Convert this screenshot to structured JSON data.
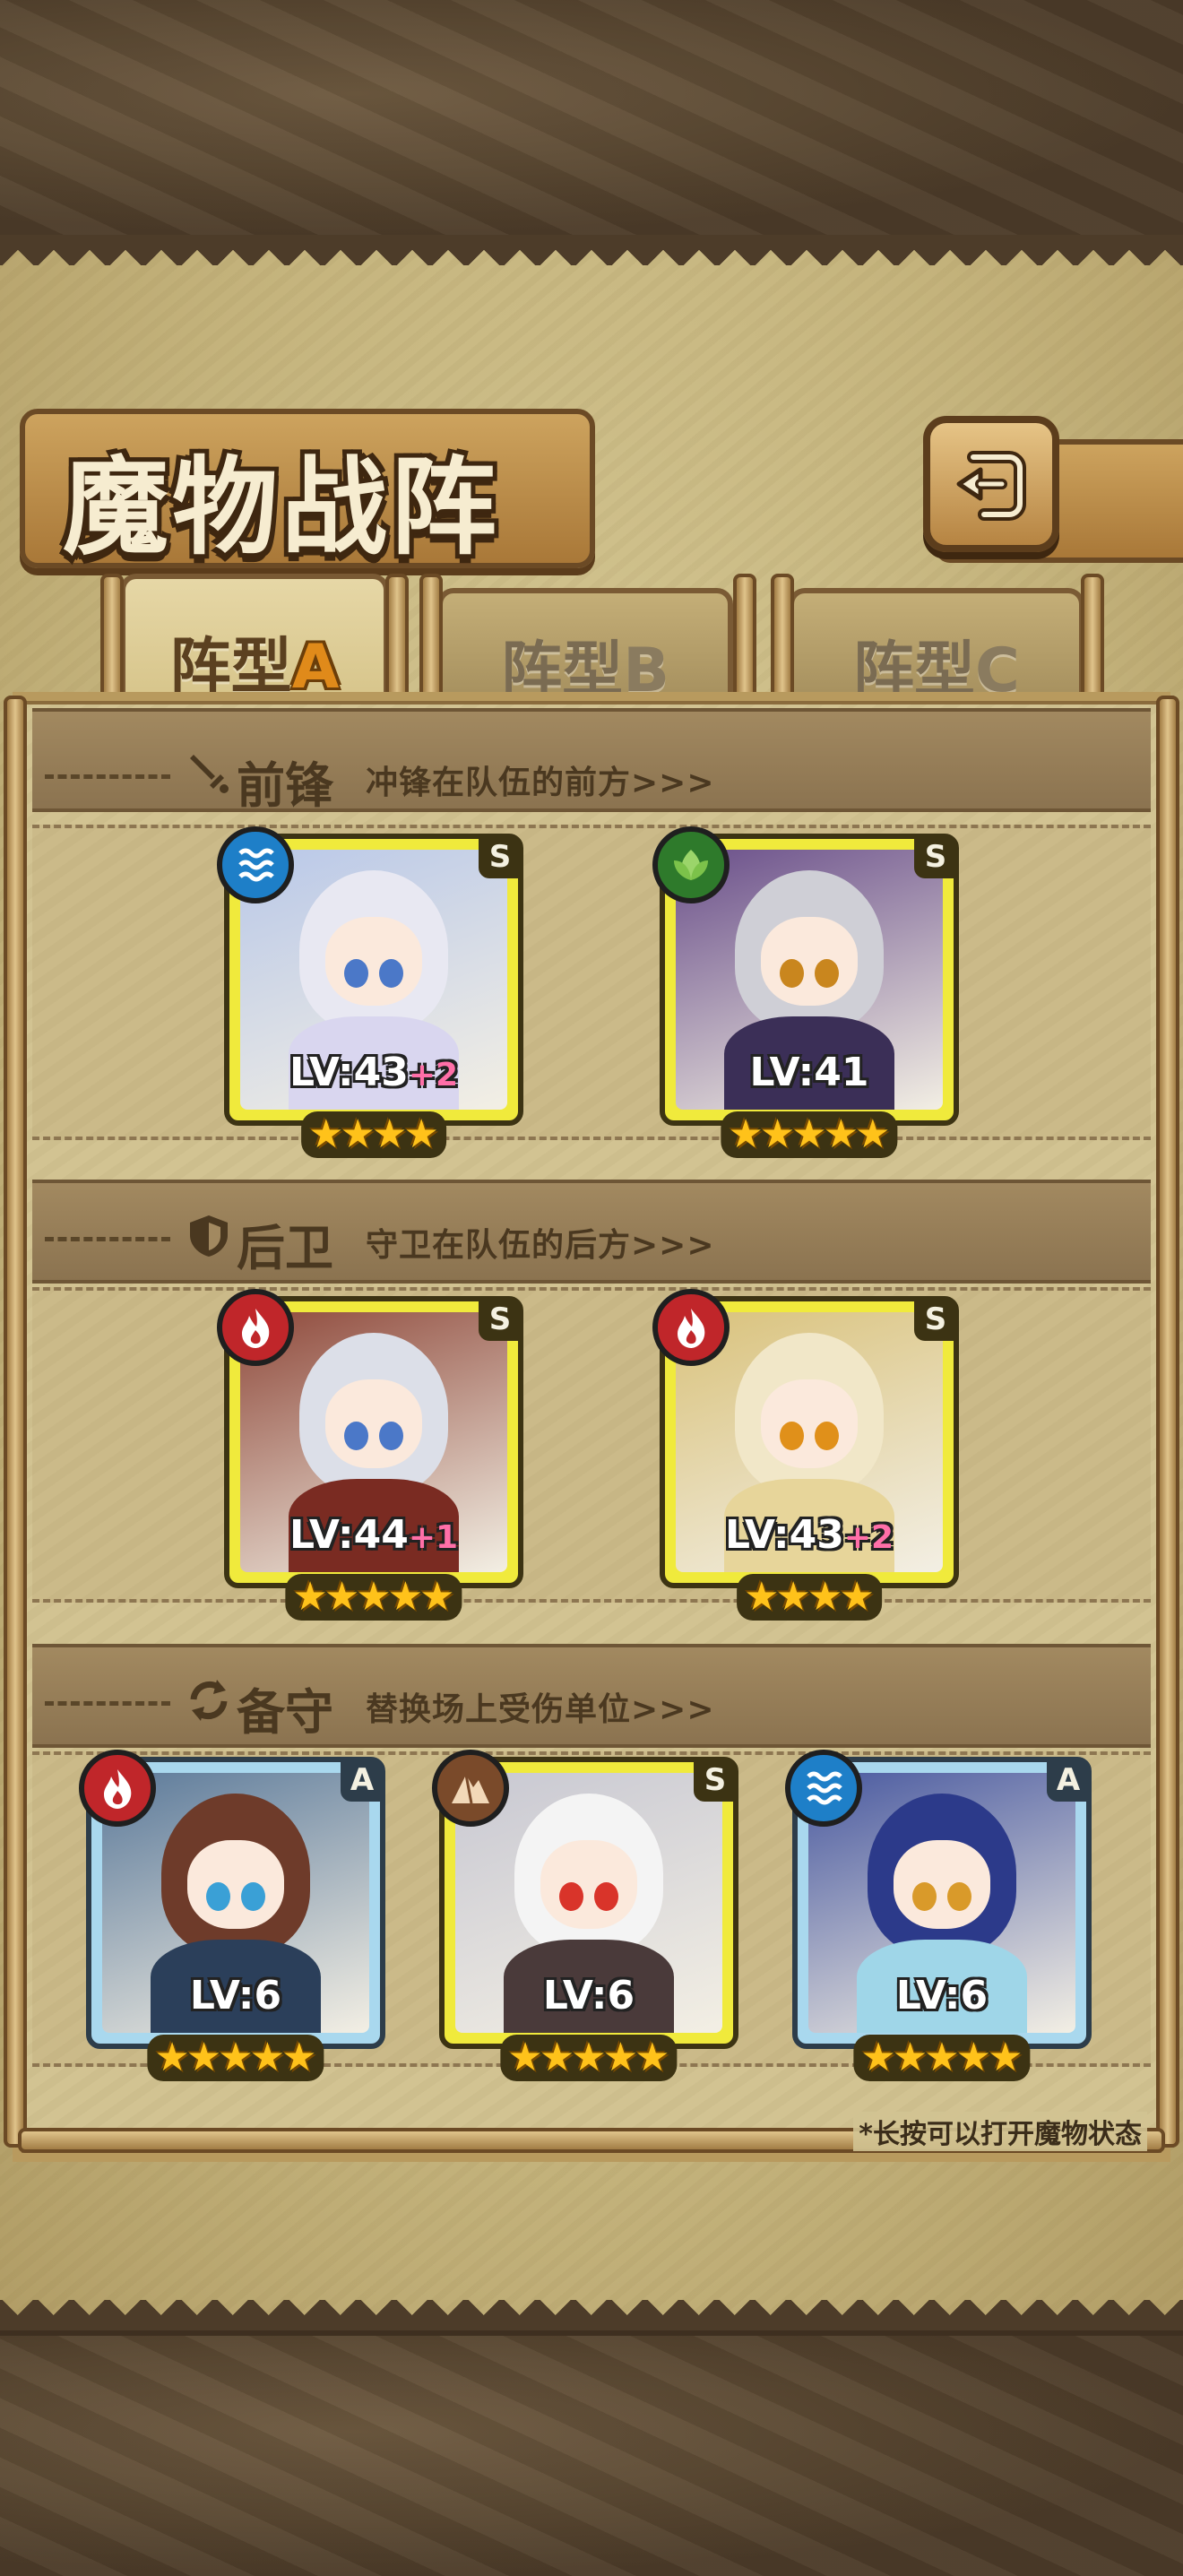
{
  "header": {
    "title": "魔物战阵",
    "back_icon": "return-arrow-icon"
  },
  "tabs": [
    {
      "prefix": "阵型",
      "letter": "A",
      "active": true
    },
    {
      "prefix": "阵型",
      "letter": "B",
      "active": false
    },
    {
      "prefix": "阵型",
      "letter": "C",
      "active": false
    }
  ],
  "sections": {
    "vanguard": {
      "icon": "sword-icon",
      "title": "前锋",
      "desc": "冲锋在队伍的前方>>>"
    },
    "rearguard": {
      "icon": "shield-icon",
      "title": "后卫",
      "desc": "守卫在队伍的后方>>>"
    },
    "reserve": {
      "icon": "swap-icon",
      "title": "备守",
      "desc": "替换场上受伤单位>>>"
    }
  },
  "units": {
    "vanguard": [
      {
        "element": "water",
        "rank": "S",
        "level": "LV:43",
        "bonus": "+2",
        "stars": 4
      },
      {
        "element": "nature",
        "rank": "S",
        "level": "LV:41",
        "bonus": "",
        "stars": 5
      }
    ],
    "rearguard": [
      {
        "element": "fire",
        "rank": "S",
        "level": "LV:44",
        "bonus": "+1",
        "stars": 5
      },
      {
        "element": "fire",
        "rank": "S",
        "level": "LV:43",
        "bonus": "+2",
        "stars": 4
      }
    ],
    "reserve": [
      {
        "element": "fire",
        "rank": "A",
        "level": "LV:6",
        "bonus": "",
        "stars": 5
      },
      {
        "element": "earth",
        "rank": "S",
        "level": "LV:6",
        "bonus": "",
        "stars": 5
      },
      {
        "element": "water",
        "rank": "A",
        "level": "LV:6",
        "bonus": "",
        "stars": 5
      }
    ]
  },
  "footer_hint": "*长按可以打开魔物状态",
  "colors": {
    "rank_s_frame": "#f0ea3c",
    "rank_a_frame": "#a9d8ee",
    "water": "#1e7fc8",
    "nature": "#2e7a2b",
    "fire": "#c0262a",
    "earth": "#7a4a2a"
  }
}
